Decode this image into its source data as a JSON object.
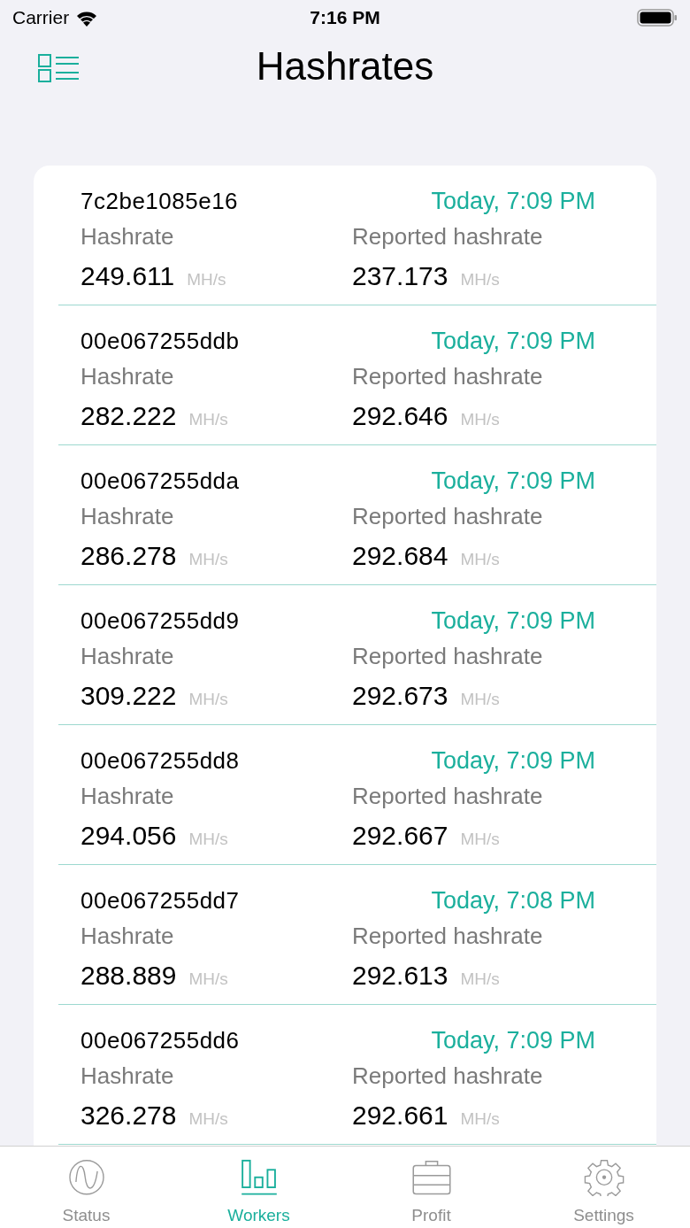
{
  "status_bar": {
    "carrier": "Carrier",
    "time": "7:16 PM"
  },
  "nav": {
    "title": "Hashrates"
  },
  "workers": [
    {
      "name": "7c2be1085e16",
      "updated": "Today, 7:09 PM",
      "hashrate_label": "Hashrate",
      "hashrate": "249.611",
      "hashrate_unit": "MH/s",
      "reported_label": "Reported hashrate",
      "reported": "237.173",
      "reported_unit": "MH/s"
    },
    {
      "name": "00e067255ddb",
      "updated": "Today, 7:09 PM",
      "hashrate_label": "Hashrate",
      "hashrate": "282.222",
      "hashrate_unit": "MH/s",
      "reported_label": "Reported hashrate",
      "reported": "292.646",
      "reported_unit": "MH/s"
    },
    {
      "name": "00e067255dda",
      "updated": "Today, 7:09 PM",
      "hashrate_label": "Hashrate",
      "hashrate": "286.278",
      "hashrate_unit": "MH/s",
      "reported_label": "Reported hashrate",
      "reported": "292.684",
      "reported_unit": "MH/s"
    },
    {
      "name": "00e067255dd9",
      "updated": "Today, 7:09 PM",
      "hashrate_label": "Hashrate",
      "hashrate": "309.222",
      "hashrate_unit": "MH/s",
      "reported_label": "Reported hashrate",
      "reported": "292.673",
      "reported_unit": "MH/s"
    },
    {
      "name": "00e067255dd8",
      "updated": "Today, 7:09 PM",
      "hashrate_label": "Hashrate",
      "hashrate": "294.056",
      "hashrate_unit": "MH/s",
      "reported_label": "Reported hashrate",
      "reported": "292.667",
      "reported_unit": "MH/s"
    },
    {
      "name": "00e067255dd7",
      "updated": "Today, 7:08 PM",
      "hashrate_label": "Hashrate",
      "hashrate": "288.889",
      "hashrate_unit": "MH/s",
      "reported_label": "Reported hashrate",
      "reported": "292.613",
      "reported_unit": "MH/s"
    },
    {
      "name": "00e067255dd6",
      "updated": "Today, 7:09 PM",
      "hashrate_label": "Hashrate",
      "hashrate": "326.278",
      "hashrate_unit": "MH/s",
      "reported_label": "Reported hashrate",
      "reported": "292.661",
      "reported_unit": "MH/s"
    }
  ],
  "tab_bar": [
    {
      "label": "Status",
      "kind": "status",
      "selected": false
    },
    {
      "label": "Workers",
      "kind": "workers",
      "selected": true
    },
    {
      "label": "Profit",
      "kind": "profit",
      "selected": false
    },
    {
      "label": "Settings",
      "kind": "settings",
      "selected": false
    }
  ]
}
